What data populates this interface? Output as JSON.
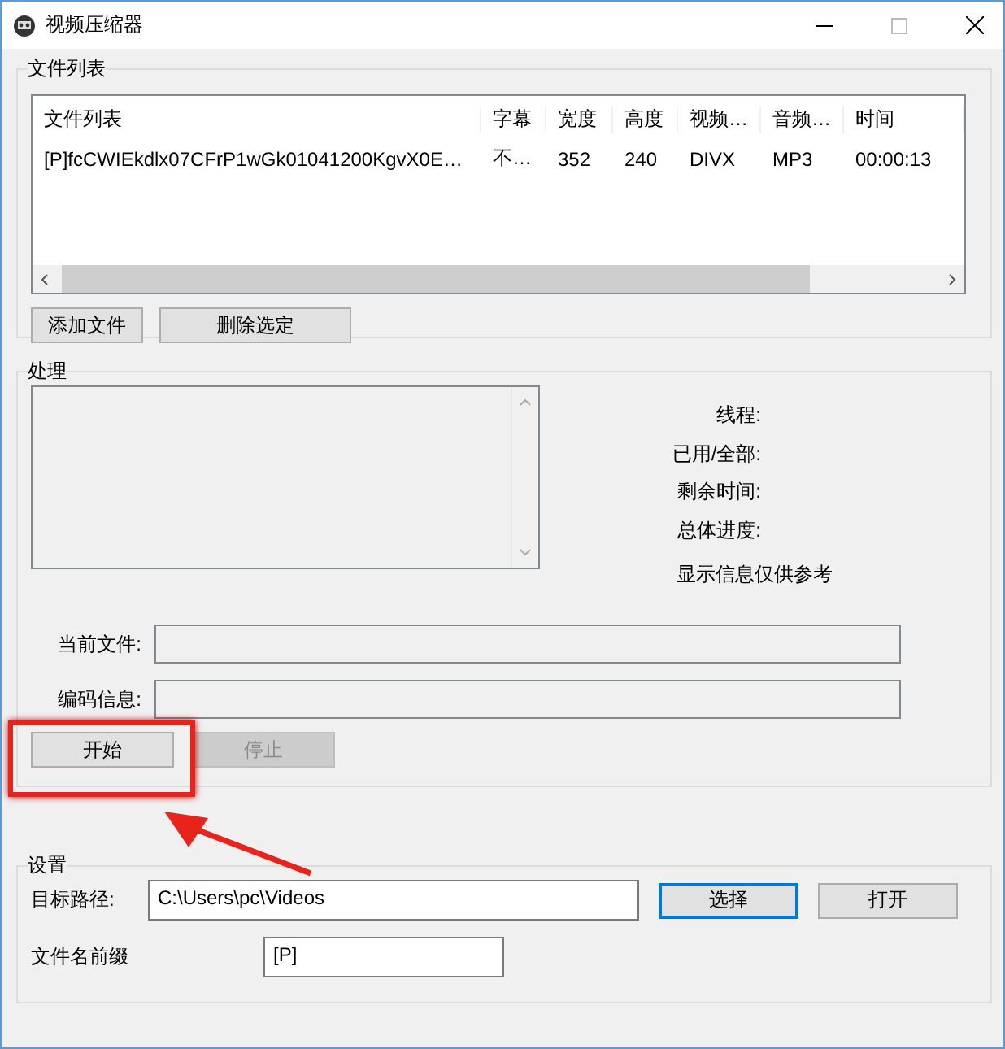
{
  "window": {
    "title": "视频压缩器"
  },
  "file_list": {
    "title": "文件列表",
    "columns": [
      "文件列表",
      "字幕",
      "宽度",
      "高度",
      "视频…",
      "音频…",
      "时间"
    ],
    "rows": [
      {
        "cells": [
          "[P]fcCWIEkdlx07CFrP1wGk01041200KgvX0E…",
          "不…",
          "352",
          "240",
          "DIVX",
          "MP3",
          "00:00:13"
        ]
      }
    ],
    "buttons": [
      {
        "label": "添加文件"
      },
      {
        "label": "删除选定"
      }
    ]
  },
  "processing": {
    "title": "处理",
    "stats": [
      "线程:",
      "已用/全部:",
      "剩余时间:",
      "总体进度:"
    ],
    "note": "显示信息仅供参考",
    "fields": [
      {
        "label": "当前文件:"
      },
      {
        "label": "编码信息:"
      }
    ],
    "buttons": [
      {
        "label": "开始",
        "disabled": false
      },
      {
        "label": "停止",
        "disabled": true
      }
    ]
  },
  "settings": {
    "title": "设置",
    "path_label": "目标路径:",
    "path_value": "C:\\Users\\pc\\Videos",
    "buttons": [
      {
        "label": "选择",
        "focused": true
      },
      {
        "label": "打开",
        "focused": false
      }
    ],
    "prefix_label": "文件名前缀",
    "prefix_value": "[P]"
  }
}
